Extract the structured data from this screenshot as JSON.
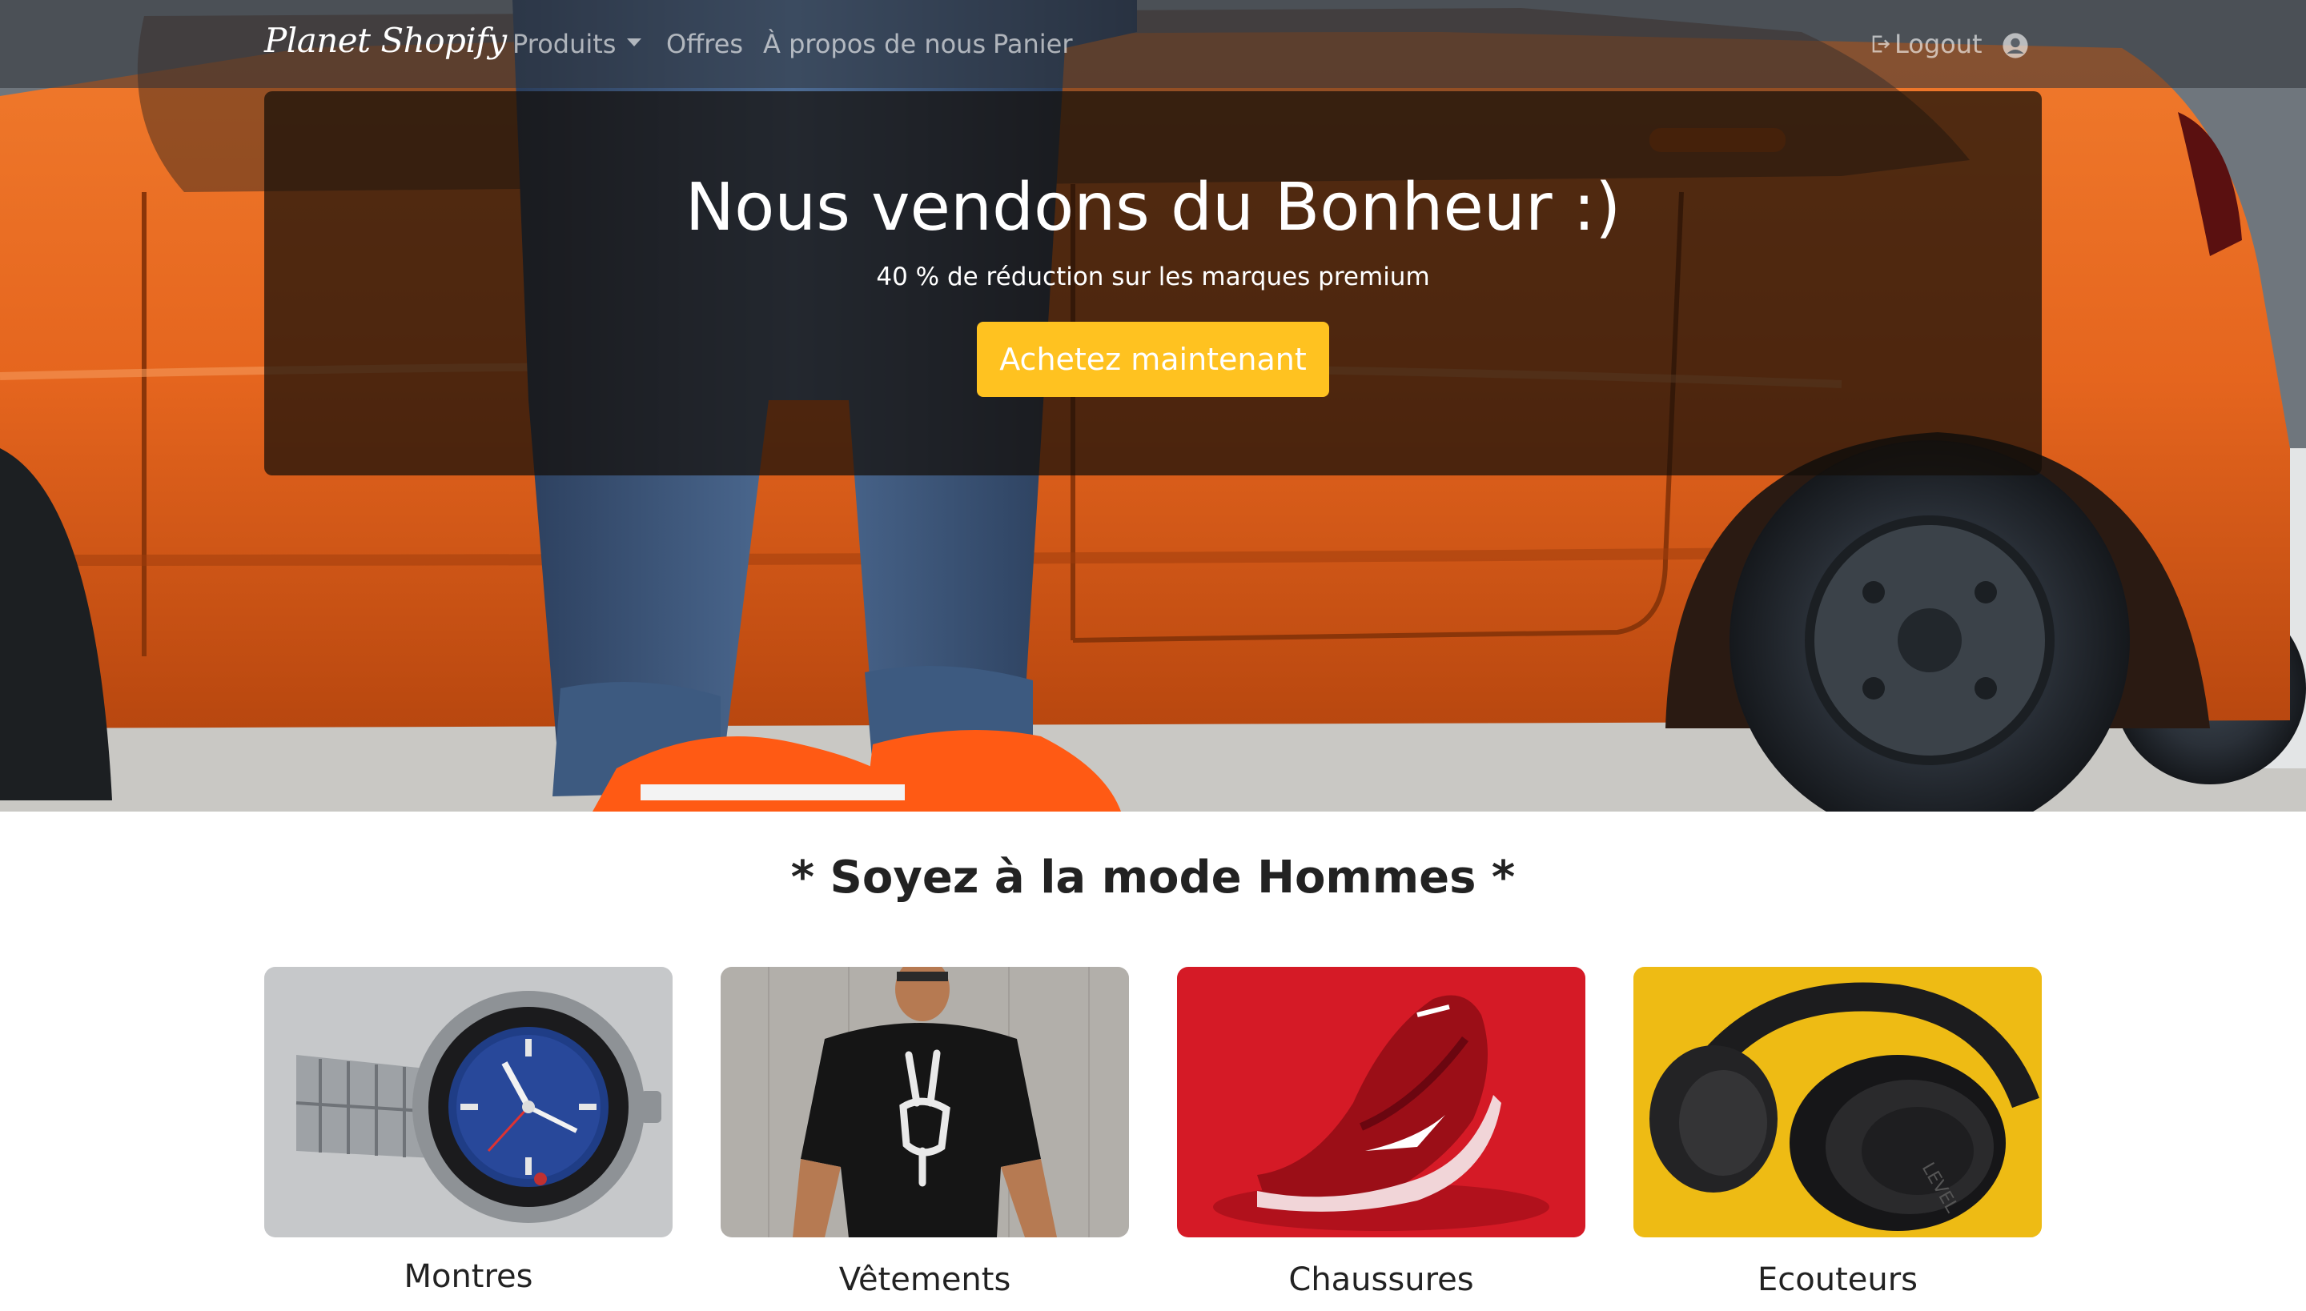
{
  "navbar": {
    "brand": "Planet Shopify",
    "links": [
      {
        "label": "Produits",
        "dropdown": true
      },
      {
        "label": "Offres"
      },
      {
        "label": "À propos de nous"
      },
      {
        "label": "Panier"
      }
    ],
    "logout_label": "Logout",
    "logout_icon": "sign-out-icon",
    "user_icon": "user-circle-icon"
  },
  "hero": {
    "title": "Nous vendons du Bonheur :)",
    "subtitle": "40 % de réduction sur les marques premium",
    "cta_label": "Achetez maintenant"
  },
  "section": {
    "title": "* Soyez à la mode Hommes *",
    "categories": [
      {
        "label": "Montres"
      },
      {
        "label": "Vêtements"
      },
      {
        "label": "Chaussures"
      },
      {
        "label": "Ecouteurs"
      }
    ]
  },
  "colors": {
    "accent": "#ffc220",
    "car_orange": "#e8641c",
    "navbar_bg": "#2d3237"
  }
}
